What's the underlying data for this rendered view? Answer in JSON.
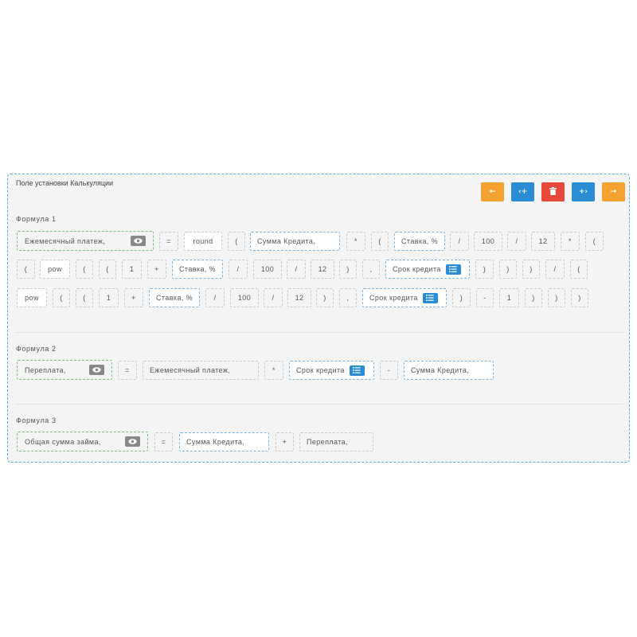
{
  "panel": {
    "title": "Поле установки Калькуляции"
  },
  "toolbar": {
    "left_arrow": "←",
    "collapse": "‹+",
    "delete": "🗑",
    "expand": "+›",
    "right_arrow": "→"
  },
  "formula1": {
    "title": "Формула 1",
    "result": "Ежемесячный платеж,",
    "tokens": [
      "=",
      "round",
      "(",
      "Сумма Кредита,",
      "*",
      "(",
      "Ставка, %",
      "/",
      "100",
      "/",
      "12",
      "*",
      "(",
      "(",
      "pow",
      "(",
      "(",
      "1",
      "+",
      "Ставка, %",
      "/",
      "100",
      "/",
      "12",
      ")",
      ",",
      "Срок кредита",
      ")",
      ")",
      ")",
      "/",
      "(",
      "pow",
      "(",
      "(",
      "1",
      "+",
      "Ставка, %",
      "/",
      "100",
      "/",
      "12",
      ")",
      ",",
      "Срок кредита",
      ")",
      "-",
      "1",
      ")",
      ")",
      ")"
    ]
  },
  "formula2": {
    "title": "Формула 2",
    "result": "Переплата,",
    "tokens": [
      "=",
      "Ежемесячный платеж,",
      "*",
      "Срок кредита",
      "-",
      "Сумма Кредита,"
    ]
  },
  "formula3": {
    "title": "Формула 3",
    "result": "Общая сумма займа,",
    "tokens": [
      "=",
      "Сумма Кредита,",
      "+",
      "Переплата,"
    ]
  },
  "colors": {
    "orange": "#f4a232",
    "blue": "#2a8dd4",
    "red": "#e7483c",
    "result_border": "#7cc27c",
    "variable_border": "#79b3e0"
  },
  "icons": {
    "eye": "eye-icon",
    "list": "list-icon",
    "trash": "trash-icon"
  }
}
